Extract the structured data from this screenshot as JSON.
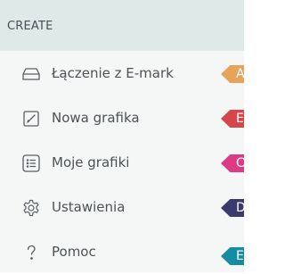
{
  "header": {
    "title": "CREATE"
  },
  "menu": {
    "items": [
      {
        "label": "Łączenie z E-mark",
        "icon": "inbox-tray-icon",
        "tag_letter": "A",
        "tag_color": "#e8a35a"
      },
      {
        "label": "Nowa grafika",
        "icon": "edit-square-icon",
        "tag_letter": "E",
        "tag_color": "#d6454a"
      },
      {
        "label": "Moje grafiki",
        "icon": "list-icon",
        "tag_letter": "C",
        "tag_color": "#dc3b86"
      },
      {
        "label": "Ustawienia",
        "icon": "gear-icon",
        "tag_letter": "D",
        "tag_color": "#3b3a6c"
      },
      {
        "label": "Pomoc",
        "icon": "question-mark-icon",
        "tag_letter": "E",
        "tag_color": "#158ca3"
      }
    ]
  }
}
